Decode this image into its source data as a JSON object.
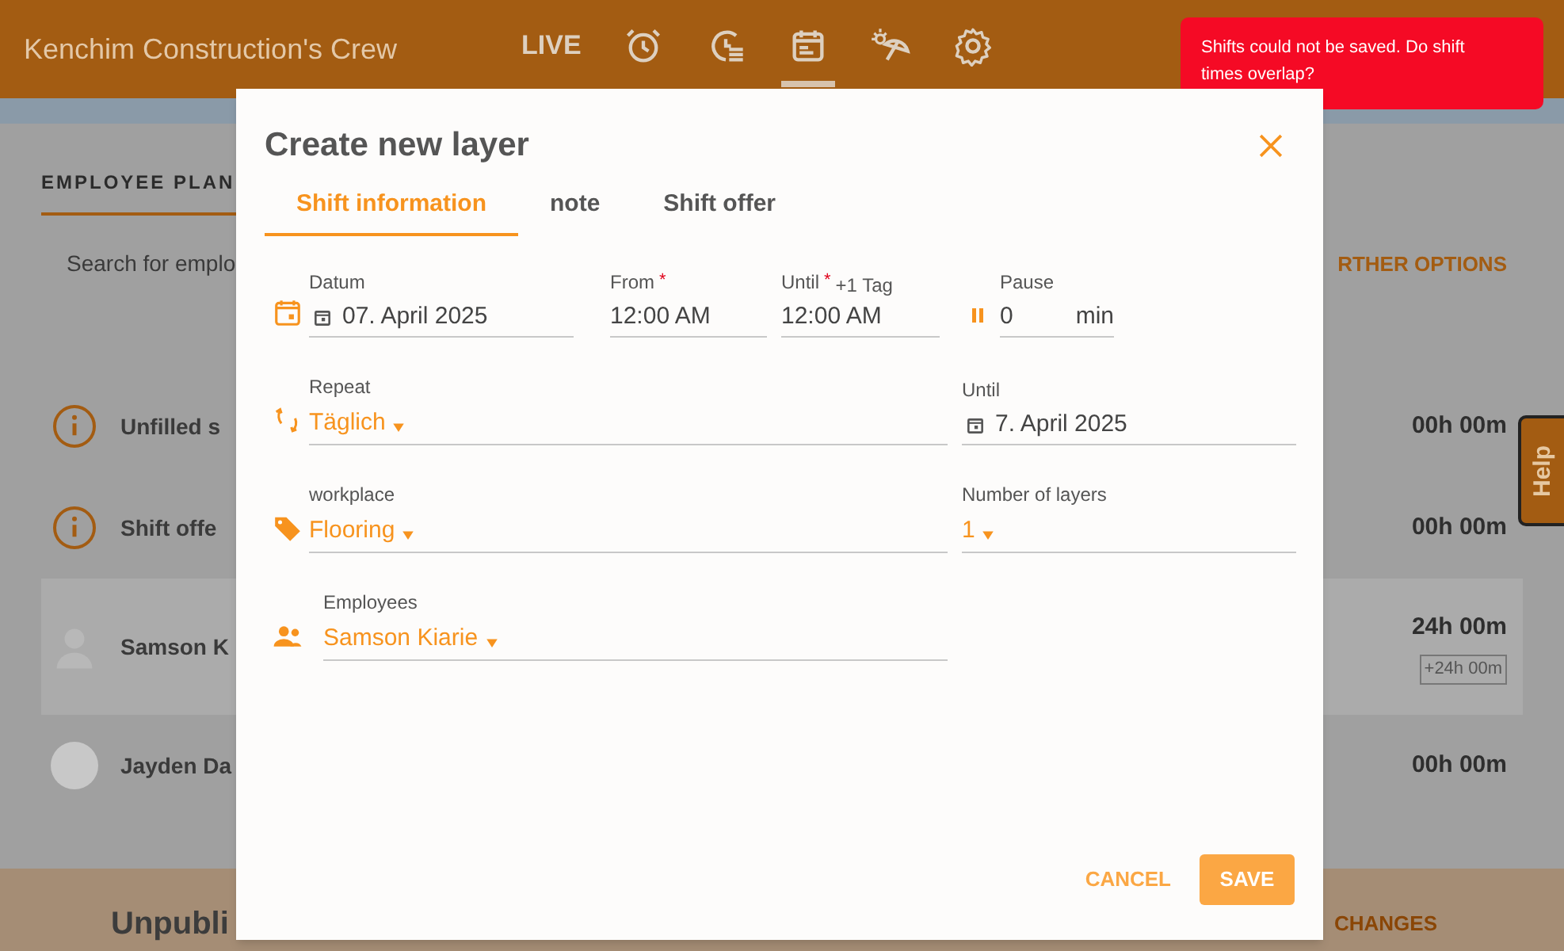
{
  "header": {
    "title": "Kenchim Construction's Crew",
    "nav": [
      {
        "label": "LIVE",
        "selected": false
      },
      {
        "selected": false
      },
      {
        "selected": false
      },
      {
        "selected": true
      },
      {
        "selected": false
      },
      {
        "selected": false
      }
    ]
  },
  "toast": {
    "message": "Shifts could not be saved. Do shift times overlap?"
  },
  "page": {
    "tab": "EMPLOYEE PLAN",
    "search_placeholder": "Search for emplo",
    "options": "RTHER OPTIONS",
    "rows": [
      {
        "kind": "info",
        "name": "Unfilled s",
        "total": "00h 00m",
        "selected": false
      },
      {
        "kind": "info",
        "name": "Shift offe",
        "total": "00h 00m",
        "selected": false
      },
      {
        "kind": "person",
        "name": "Samson K",
        "total": "24h 00m",
        "extra": "+24h 00m",
        "selected": true
      },
      {
        "kind": "photo",
        "name": "Jayden Da",
        "total": "00h 00m",
        "selected": false
      }
    ],
    "footer_title": "Unpubli",
    "footer_action": "CHANGES",
    "help": "Help"
  },
  "dialog": {
    "title": "Create new layer",
    "tabs": [
      {
        "label": "Shift information",
        "selected": true
      },
      {
        "label": "note",
        "selected": false
      },
      {
        "label": "Shift offer",
        "selected": false
      }
    ],
    "date": {
      "label": "Datum",
      "value": "07. April 2025"
    },
    "from": {
      "label": "From",
      "required_mark": "*",
      "value": "12:00 AM"
    },
    "until": {
      "label": "Until",
      "required_mark": "*",
      "note": "+1 Tag",
      "value": "12:00 AM"
    },
    "pause": {
      "label": "Pause",
      "value": "0",
      "unit": "min"
    },
    "repeat": {
      "label": "Repeat",
      "value": "Täglich"
    },
    "repeat_until": {
      "label": "Until",
      "value": "7. April 2025"
    },
    "workplace": {
      "label": "workplace",
      "value": "Flooring"
    },
    "layers": {
      "label": "Number of layers",
      "value": "1"
    },
    "employees": {
      "label": "Employees",
      "value": "Samson Kiarie"
    },
    "buttons": [
      {
        "kind": "text",
        "label": "CANCEL"
      },
      {
        "kind": "filled",
        "label": "SAVE"
      }
    ]
  }
}
